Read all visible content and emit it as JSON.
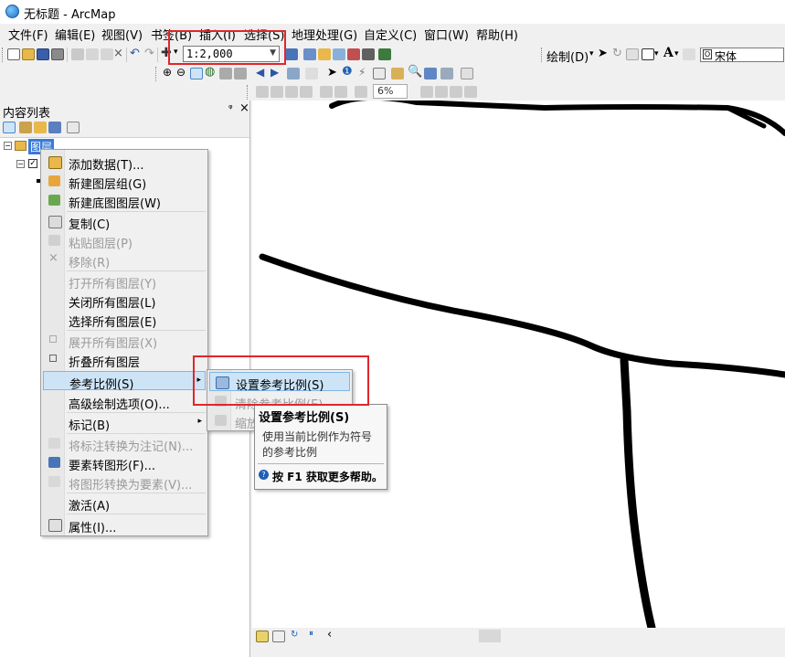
{
  "window": {
    "title": "无标题 - ArcMap"
  },
  "menubar": [
    "文件(F)",
    "编辑(E)",
    "视图(V)",
    "书签(B)",
    "插入(I)",
    "选择(S)",
    "地理处理(G)",
    "自定义(C)",
    "窗口(W)",
    "帮助(H)"
  ],
  "toolbar": {
    "scale_value": "1:2,000",
    "draw_label": "绘制(D)",
    "font_value": "宋体",
    "zoom_percent": "6%"
  },
  "toc": {
    "title": "内容列表",
    "pin_glyph": "ᵠ",
    "close_glyph": "×",
    "root_layer": "图层"
  },
  "context_menu": {
    "items": [
      {
        "label": "添加数据(T)...",
        "icon": "add-data-icon",
        "enabled": true
      },
      {
        "label": "新建图层组(G)",
        "icon": "new-group-layer-icon",
        "enabled": true
      },
      {
        "label": "新建底图图层(W)",
        "icon": "new-basemap-layer-icon",
        "enabled": true
      },
      {
        "label": "复制(C)",
        "icon": "copy-icon",
        "enabled": true
      },
      {
        "label": "粘贴图层(P)",
        "icon": "paste-icon",
        "enabled": false
      },
      {
        "label": "移除(R)",
        "icon": "remove-icon",
        "enabled": false
      },
      {
        "label": "打开所有图层(Y)",
        "icon": "",
        "enabled": false
      },
      {
        "label": "关闭所有图层(L)",
        "icon": "",
        "enabled": true
      },
      {
        "label": "选择所有图层(E)",
        "icon": "",
        "enabled": true
      },
      {
        "label": "展开所有图层(X)",
        "icon": "expand-icon",
        "enabled": false
      },
      {
        "label": "折叠所有图层",
        "icon": "collapse-icon",
        "enabled": true
      },
      {
        "label": "参考比例(S)",
        "icon": "",
        "enabled": true,
        "submenu": true
      },
      {
        "label": "高级绘制选项(O)...",
        "icon": "",
        "enabled": true
      },
      {
        "label": "标记(B)",
        "icon": "",
        "enabled": true,
        "submenu": true
      },
      {
        "label": "将标注转换为注记(N)...",
        "icon": "convert-labels-icon",
        "enabled": false
      },
      {
        "label": "要素转图形(F)...",
        "icon": "features-to-graphics-icon",
        "enabled": true
      },
      {
        "label": "将图形转换为要素(V)...",
        "icon": "graphics-to-features-icon",
        "enabled": false
      },
      {
        "label": "激活(A)",
        "icon": "",
        "enabled": true
      },
      {
        "label": "属性(I)...",
        "icon": "properties-icon",
        "enabled": true
      }
    ]
  },
  "submenu": {
    "items": [
      {
        "label": "设置参考比例(S)",
        "enabled": true
      },
      {
        "label": "清除参考比例(E)",
        "enabled": false
      },
      {
        "label": "缩放",
        "enabled": false
      }
    ]
  },
  "tooltip": {
    "title": "设置参考比例(S)",
    "body_line1": "使用当前比例作为符号",
    "body_line2": "的参考比例",
    "help": "按 F1 获取更多帮助。"
  },
  "colors": {
    "highlight": "#cde4f7",
    "annotation_red": "#e0262a"
  }
}
